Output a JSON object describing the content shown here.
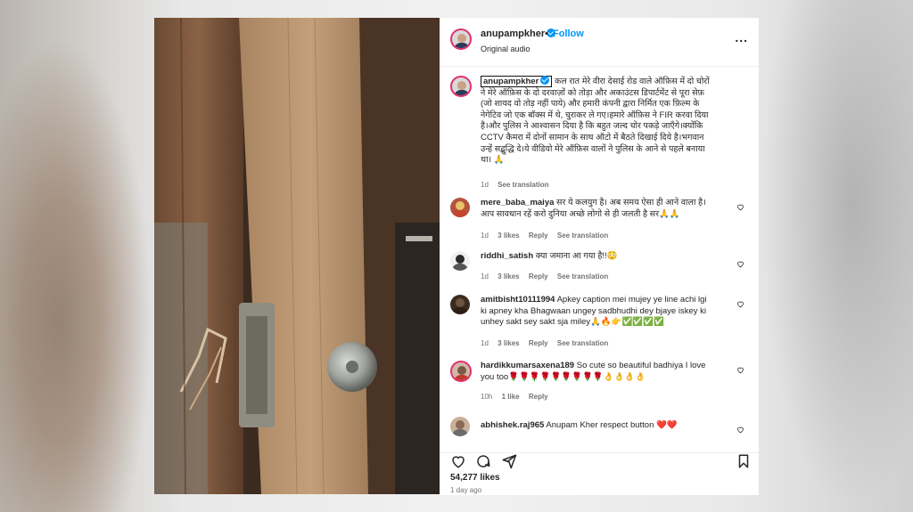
{
  "post": {
    "username": "anupampkher",
    "follow_label": "Follow",
    "separator": "•",
    "audio": "Original audio",
    "more_label": "..."
  },
  "caption": {
    "username": "anupampkher",
    "text": "कल रात मेरे वीरा देसाई रोड वाले ऑफ़िस में दो चोरों ने मेरे ऑफ़िस के दो दरवाज़ों को तोड़ा और अकाउंटस डिपार्टमेंट से पूरा सेफ़ (जो शायद वो तोड़ नहीं पाये) और हमारी कंपनी द्वारा निर्मित एक फ़िल्म के नेगेटिव जो एक बॉक्स में थे, चुराकर ले गए।हमारे ऑफ़िस ने FIR करवा दिया है।और पुलिस ने आश्वासन दिया है कि बहुत जल्द चोर पकड़े जाएँगे।क्योंकि CCTV कैमरा में दोनों सामान के साथ ऑटो में बैठते दिखाई दिये है।भगवान उन्हें सद्बुद्धि दे।ये वीडियो मेरे ऑफ़िस वालों ने पुलिस के आने से पहले बनाया था। 🙏",
    "time": "1d",
    "translate": "See translation"
  },
  "comments": [
    {
      "username": "mere_baba_maiya",
      "text": "सर ये कलयुग है। अब समय ऐसा ही आने वाला है। आप सावधान रहें करो दुनिया अच्छे लोगो से ही जलती है सर🙏🙏",
      "time": "1d",
      "likes": "3 likes",
      "reply": "Reply",
      "translate": "See translation"
    },
    {
      "username": "riddhi_satish",
      "text": "क्या जमाना आ गया है!!😳",
      "time": "1d",
      "likes": "3 likes",
      "reply": "Reply",
      "translate": "See translation"
    },
    {
      "username": "amitbisht10111994",
      "text": "Apkey caption mei mujey ye line achi lgi ki apney kha Bhagwaan ungey sadbhudhi dey bjaye iskey ki unhey sakt sey sakt sja miley🙏🔥👉✅✅✅✅",
      "time": "1d",
      "likes": "3 likes",
      "reply": "Reply",
      "translate": "See translation"
    },
    {
      "username": "hardikkumarsaxena189",
      "text": "So cute so beautiful badhiya I love you too🌹🌹🌹🌹🌹🌹🌹🌹🌹👌👌👌👌",
      "time": "10h",
      "likes": "1 like",
      "reply": "Reply"
    },
    {
      "username": "abhishek.raj965",
      "text": "Anupam Kher respect button ❤️❤️"
    }
  ],
  "footer": {
    "likes": "54,277 likes",
    "ago": "1 day ago"
  },
  "icons": [
    "heart-icon",
    "comment-icon",
    "share-icon",
    "bookmark-icon",
    "verified-icon",
    "more-icon"
  ],
  "colors": {
    "accent": "#0095f6",
    "text": "#262626",
    "muted": "#737373"
  }
}
